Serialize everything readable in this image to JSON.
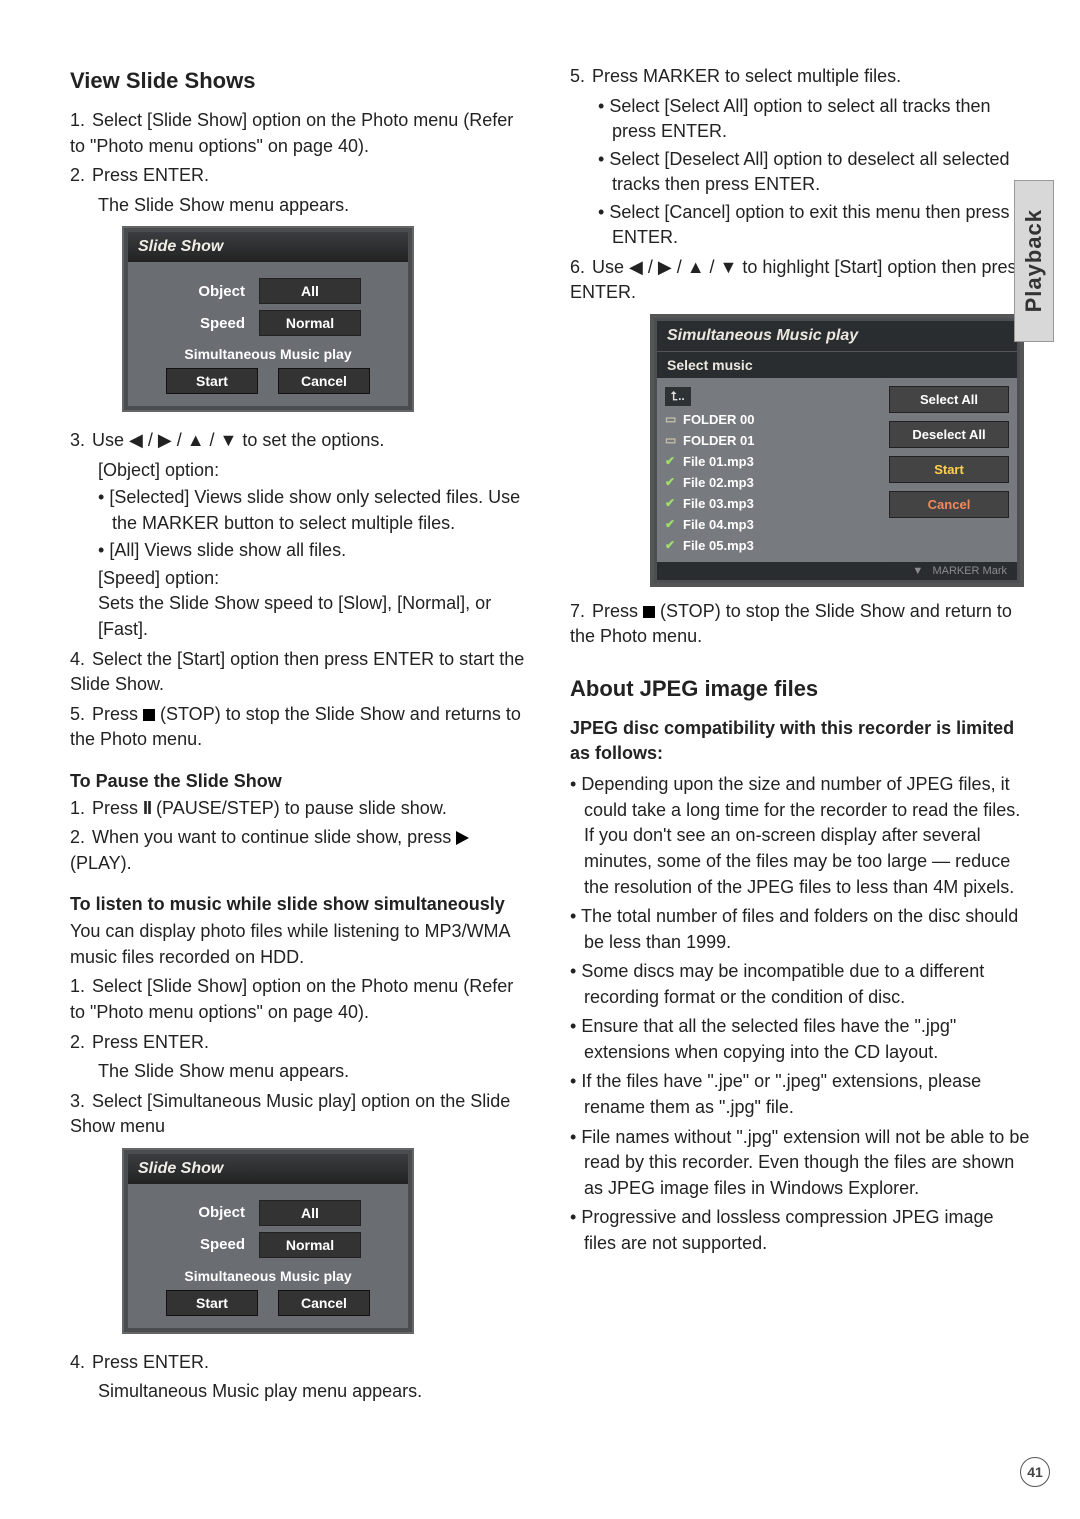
{
  "side_tab": "Playback",
  "page_number": "41",
  "left": {
    "h_view": "View Slide Shows",
    "s1": "Select [Slide Show] option on the Photo menu (Refer to \"Photo menu options\" on page 40).",
    "s2a": "Press ENTER.",
    "s2b": "The Slide Show menu appears.",
    "ss": {
      "title": "Slide Show",
      "obj_l": "Object",
      "obj_v": "All",
      "spd_l": "Speed",
      "spd_v": "Normal",
      "smp": "Simultaneous Music play",
      "start": "Start",
      "cancel": "Cancel"
    },
    "s3a": "Use ◀ / ▶ / ▲ / ▼ to set the options.",
    "s3b": "[Object] option:",
    "s3_b1": "[Selected] Views slide show only selected files. Use the MARKER button to select multiple files.",
    "s3_b2": "[All] Views slide show all files.",
    "s3c": "[Speed] option:",
    "s3d": "Sets the Slide Show speed to [Slow], [Normal], or [Fast].",
    "s4": "Select the [Start] option then press ENTER to start the Slide Show.",
    "s5a": "Press ",
    "s5b": " (STOP) to stop the Slide Show and returns to the Photo menu.",
    "h_pause": "To Pause the Slide Show",
    "p1a": "Press ",
    "p1_ii": "II",
    "p1b": " (PAUSE/STEP) to pause slide show.",
    "p2a": "When you want to continue slide show, press ",
    "p2b": " (PLAY).",
    "h_listen": "To listen to music while slide show simultaneously",
    "listen_intro": "You can display photo files while listening to MP3/WMA music files recorded on HDD.",
    "l1": "Select [Slide Show] option on the Photo menu (Refer to \"Photo menu options\" on page 40).",
    "l2a": "Press ENTER.",
    "l2b": "The Slide Show menu appears.",
    "l3": "Select [Simultaneous Music play] option on the Slide Show menu",
    "l4a": "Press ENTER.",
    "l4b": "Simultaneous Music play menu appears."
  },
  "right": {
    "r5": "Press MARKER to select multiple files.",
    "r5_b1": "Select [Select All] option to select all tracks then press ENTER.",
    "r5_b2": "Select [Deselect All] option to deselect all selected tracks then press ENTER.",
    "r5_b3": "Select [Cancel] option to exit this menu then press ENTER.",
    "r6": "Use ◀ / ▶ / ▲ / ▼ to highlight [Start] option then press ENTER.",
    "smp": {
      "title": "Simultaneous Music play",
      "sub": "Select  music",
      "up": "⮤..",
      "items": [
        "FOLDER 00",
        "FOLDER 01",
        "File 01.mp3",
        "File 02.mp3",
        "File 03.mp3",
        "File 04.mp3",
        "File 05.mp3"
      ],
      "folders": [
        true,
        true,
        false,
        false,
        false,
        false,
        false
      ],
      "side": [
        "Select All",
        "Deselect All",
        "Start",
        "Cancel"
      ],
      "foot": "MARKER Mark"
    },
    "r7a": "Press ",
    "r7b": " (STOP) to stop the Slide Show and return to the Photo menu.",
    "h_jpeg": "About JPEG image files",
    "jpeg_lead": "JPEG disc compatibility with this recorder is limited as follows:",
    "jb1": "Depending upon the size and number of JPEG files, it could take a long time for the recorder to read the files. If you don't see an on-screen display after several minutes, some of the files may be too large — reduce the resolution of the JPEG files to less than 4M pixels.",
    "jb2": "The total number of files and folders on the disc should be less than 1999.",
    "jb3": "Some discs may be incompatible due to a different recording format or the condition of disc.",
    "jb4": "Ensure that all the selected files have the \".jpg\" extensions when copying into the CD layout.",
    "jb5": "If the files have \".jpe\" or \".jpeg\" extensions, please rename them as \".jpg\" file.",
    "jb6": "File names without \".jpg\" extension will not be able to be read by this recorder. Even though the files are shown as JPEG image files in Windows Explorer.",
    "jb7": "Progressive and lossless compression JPEG image files are not supported."
  }
}
